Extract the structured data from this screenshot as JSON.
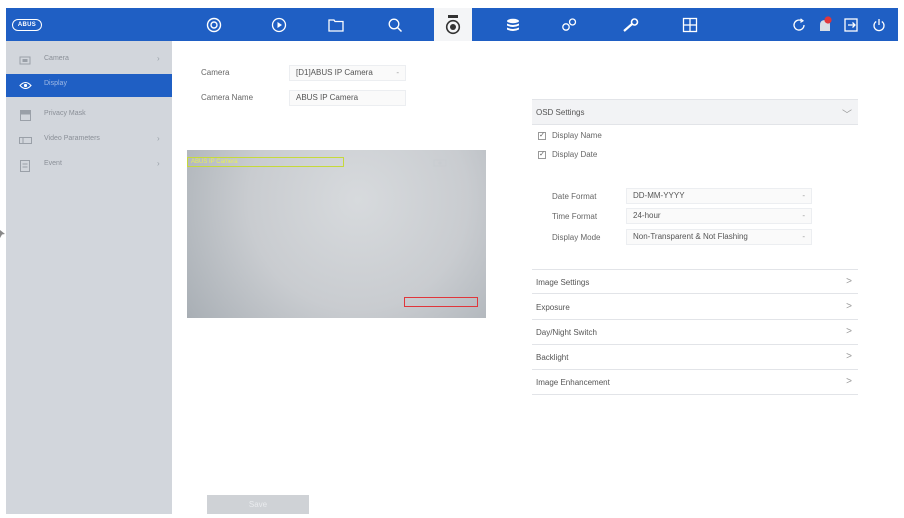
{
  "brand": {
    "logo_text": "ABUS"
  },
  "topbar": {
    "icons": [
      "live-view-icon",
      "playback-icon",
      "file-icon",
      "search-icon",
      "camera-icon",
      "storage-icon",
      "system-config-icon",
      "maintenance-icon",
      "layout-icon"
    ],
    "active": "camera-icon",
    "right_icons": [
      "refresh-icon",
      "alarm-icon",
      "logout-icon",
      "power-icon"
    ],
    "accent": "#1f5fc4"
  },
  "sidebar": {
    "items": [
      {
        "label": "Camera",
        "icon": "camera-small-icon",
        "has_arrow": true
      },
      {
        "label": "Display",
        "icon": "eye-icon",
        "has_arrow": false,
        "active": true
      },
      {
        "label": "Privacy Mask",
        "icon": "mask-icon",
        "has_arrow": false
      },
      {
        "label": "Video Parameters",
        "icon": "video-icon",
        "has_arrow": true
      },
      {
        "label": "Event",
        "icon": "event-icon",
        "has_arrow": true
      }
    ]
  },
  "form": {
    "camera_label": "Camera",
    "camera_value": "[D1]ABUS IP Camera",
    "camera_name_label": "Camera Name",
    "camera_name_value": "ABUS IP Camera"
  },
  "osd": {
    "header": "OSD Settings",
    "display_name_label": "Display Name",
    "display_name_checked": true,
    "display_date_label": "Display Date",
    "display_date_checked": true,
    "date_format_label": "Date Format",
    "date_format_value": "DD-MM-YYYY",
    "time_format_label": "Time Format",
    "time_format_value": "24-hour",
    "display_mode_label": "Display Mode",
    "display_mode_value": "Non-Transparent & Not Flashing"
  },
  "sections": [
    {
      "label": "Image Settings"
    },
    {
      "label": "Exposure"
    },
    {
      "label": "Day/Night Switch"
    },
    {
      "label": "Backlight"
    },
    {
      "label": "Image Enhancement"
    }
  ],
  "save_label": "Save",
  "arrows": {
    "collapsed": ">",
    "expanded": "﹀",
    "sidebar": "›",
    "select": "-"
  },
  "checkbox_mark": "✓"
}
